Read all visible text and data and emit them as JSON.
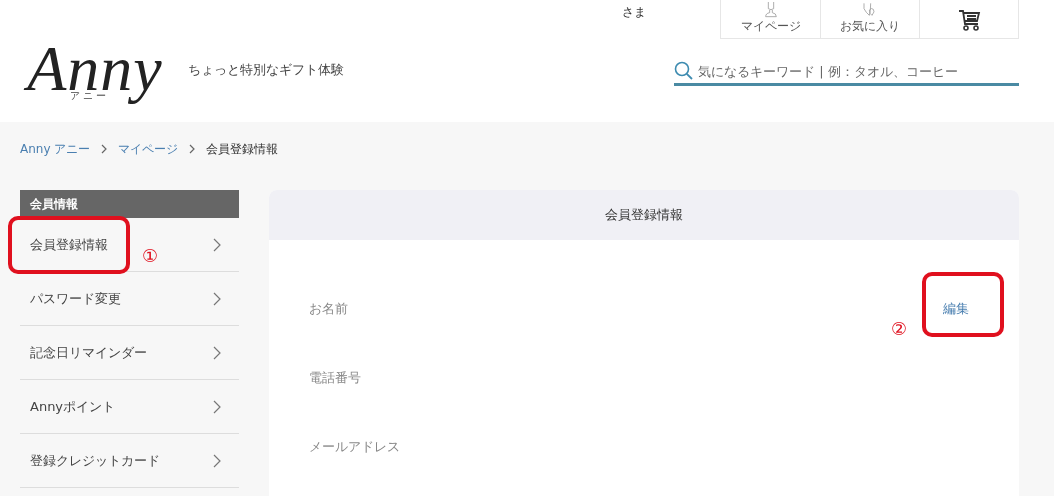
{
  "header": {
    "user_suffix": "さま",
    "nav": [
      {
        "label": "マイページ",
        "kind": "person"
      },
      {
        "label": "お気に入り",
        "kind": "heart"
      },
      {
        "kind": "cart"
      }
    ],
    "logo": {
      "name": "Anny",
      "reading": "アニー"
    },
    "tagline": "ちょっと特別なギフト体験",
    "search": {
      "placeholder": "気になるキーワード | 例：タオル、コーヒー"
    }
  },
  "breadcrumb": [
    {
      "label": "Anny アニー",
      "link": true
    },
    {
      "label": "マイページ",
      "link": true
    },
    {
      "label": "会員登録情報",
      "link": false
    }
  ],
  "sidebar": {
    "heading": "会員情報",
    "items": [
      {
        "label": "会員登録情報"
      },
      {
        "label": "パスワード変更"
      },
      {
        "label": "記念日リマインダー"
      },
      {
        "label": "Annyポイント"
      },
      {
        "label": "登録クレジットカード"
      }
    ]
  },
  "card": {
    "title": "会員登録情報",
    "edit": "編集",
    "fields": [
      {
        "label": "お名前"
      },
      {
        "label": "電話番号"
      },
      {
        "label": "メールアドレス"
      }
    ]
  },
  "annotations": [
    {
      "label": "①"
    },
    {
      "label": "②"
    }
  ]
}
